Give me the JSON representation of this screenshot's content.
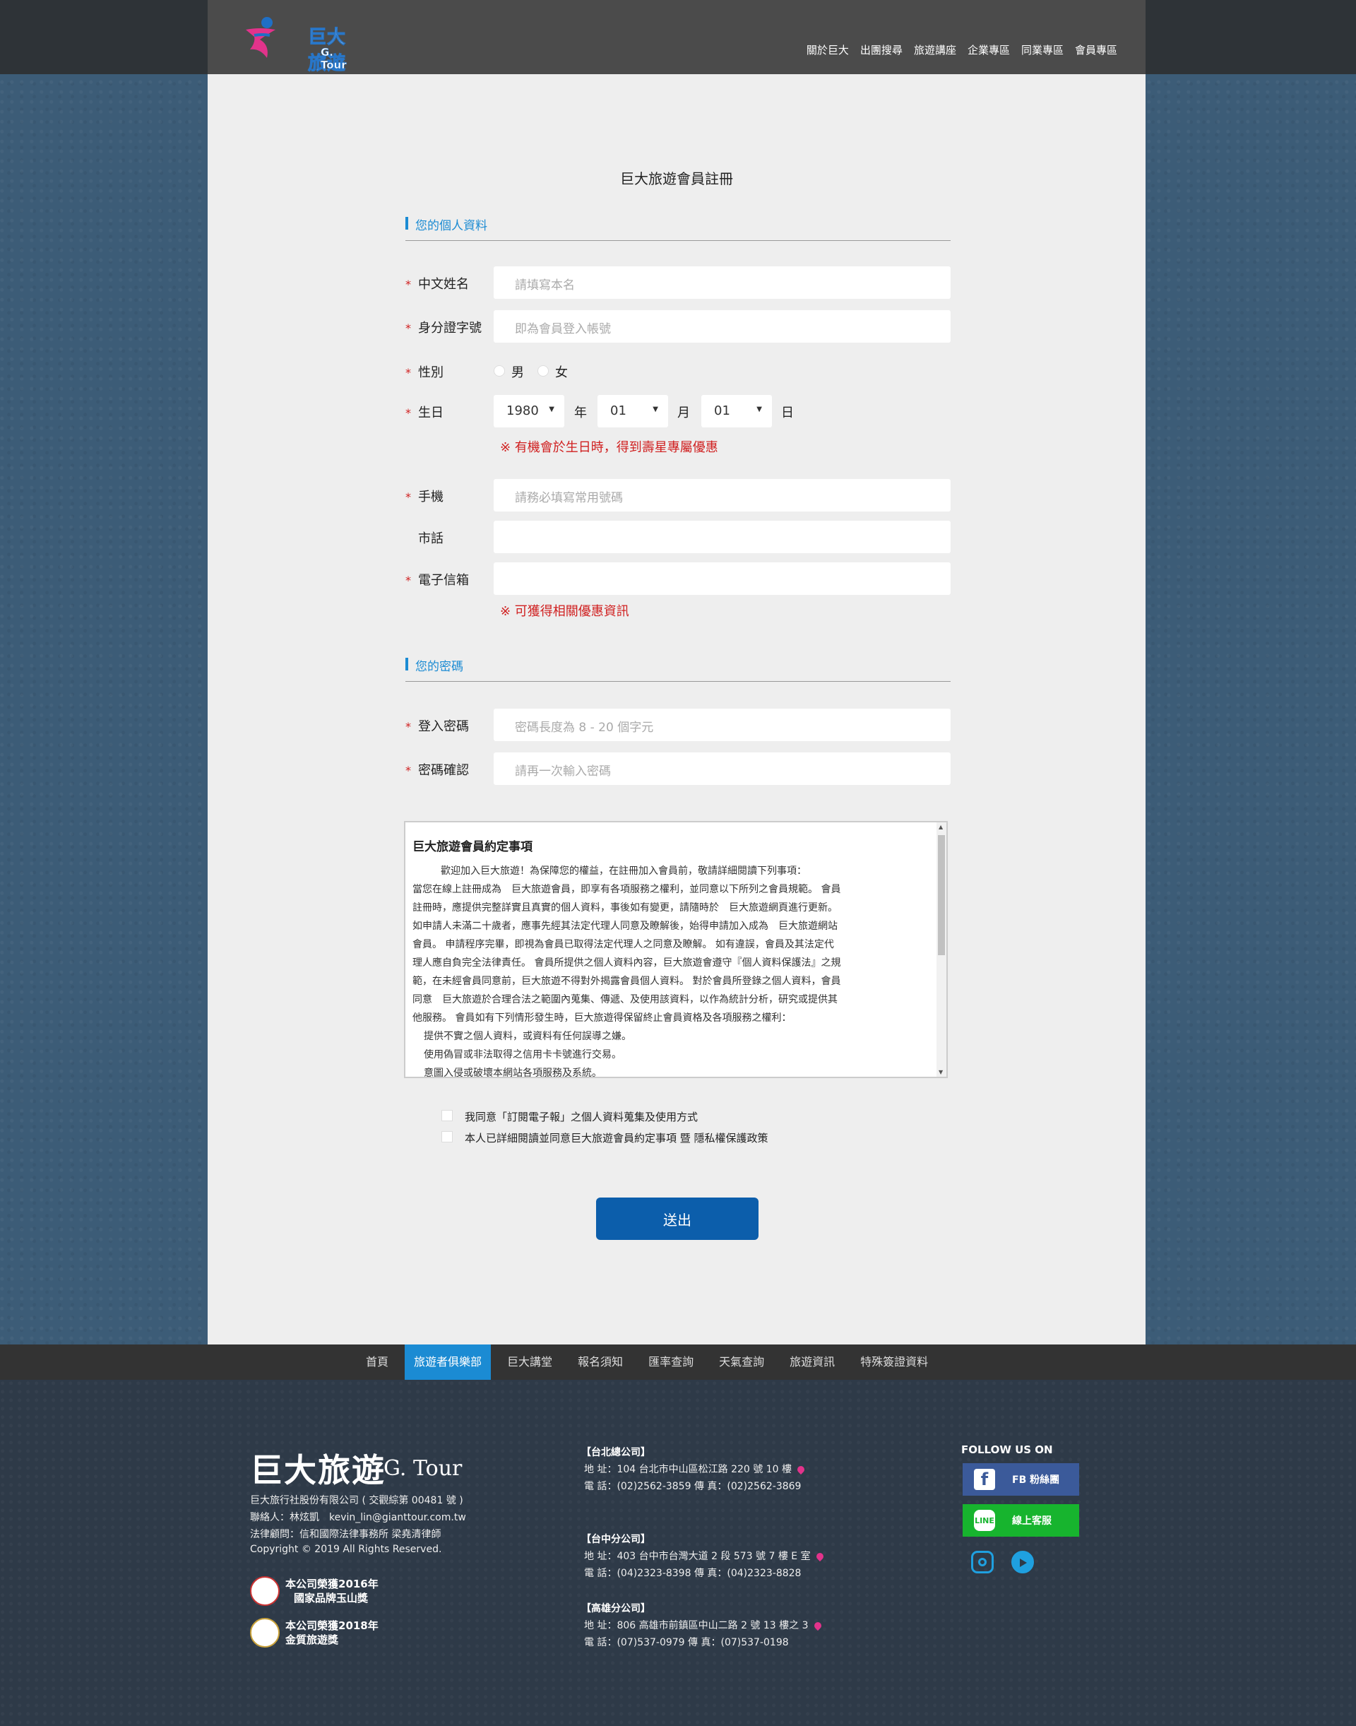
{
  "header": {
    "logo_main": "巨大旅遊",
    "logo_sub": "G. Tour",
    "nav": [
      "關於巨大",
      "出團搜尋",
      "旅遊講座",
      "企業專區",
      "同業專區",
      "會員專區"
    ]
  },
  "form": {
    "title": "巨大旅遊會員註冊",
    "section_personal": "您的個人資料",
    "section_password": "您的密碼",
    "required_mark": "*",
    "fields": {
      "name": {
        "label": "中文姓名",
        "placeholder": "請填寫本名"
      },
      "id_number": {
        "label": "身分證字號",
        "placeholder": "即為會員登入帳號"
      },
      "gender": {
        "label": "性別",
        "male": "男",
        "female": "女"
      },
      "birthday": {
        "label": "生日",
        "year": "1980",
        "month": "01",
        "day": "01",
        "year_unit": "年",
        "month_unit": "月",
        "day_unit": "日",
        "note": "※ 有機會於生日時，得到壽星專屬優惠"
      },
      "mobile": {
        "label": "手機",
        "placeholder": "請務必填寫常用號碼"
      },
      "phone": {
        "label": "市話",
        "placeholder": ""
      },
      "email": {
        "label": "電子信箱",
        "placeholder": "",
        "note": "※ 可獲得相關優惠資訊"
      },
      "password": {
        "label": "登入密碼",
        "placeholder": "密碼長度為 8 - 20 個字元"
      },
      "password_confirm": {
        "label": "密碼確認",
        "placeholder": "請再一次輸入密碼"
      }
    },
    "terms": {
      "title": "巨大旅遊會員約定事項",
      "lines": [
        "歡迎加入巨大旅遊！為保障您的權益，在註冊加入會員前，敬請詳細閱讀下列事項：",
        "當您在線上註冊成為　巨大旅遊會員，即享有各項服務之權利，並同意以下所列之會員規範。 會員",
        "註冊時，應提供完整詳實且真實的個人資料，事後如有變更，請隨時於　巨大旅遊網頁進行更新。",
        "如申請人未滿二十歲者，應事先經其法定代理人同意及瞭解後，始得申請加入成為　巨大旅遊網站",
        "會員。 申請程序完畢，即視為會員已取得法定代理人之同意及瞭解。 如有違誤，會員及其法定代",
        "理人應自負完全法律責任。 會員所提供之個人資料內容，巨大旅遊會遵守『個人資料保護法』之規",
        "範，在未經會員同意前，巨大旅遊不得對外揭露會員個人資料。 對於會員所登錄之個人資料，會員",
        "同意　巨大旅遊於合理合法之範圍內蒐集、傳遞、及使用該資料，以作為統計分析，研究或提供其",
        "他服務。 會員如有下列情形發生時，巨大旅遊得保留終止會員資格及各項服務之權利：",
        "提供不實之個人資料，或資料有任何誤導之嫌。",
        "使用偽冒或非法取得之信用卡卡號進行交易。",
        "意圖入侵或破壞本網站各項服務及系統。"
      ]
    },
    "agree_newsletter": "我同意「訂閱電子報」之個人資料蒐集及使用方式",
    "agree_terms": "本人已詳細閱讀並同意巨大旅遊會員約定事項 暨 隱私權保護政策",
    "submit": "送出"
  },
  "bottom_nav": [
    "首頁",
    "旅遊者俱樂部",
    "巨大講堂",
    "報名須知",
    "匯率查詢",
    "天氣查詢",
    "旅遊資訊",
    "特殊簽證資料"
  ],
  "bottom_nav_active": 1,
  "footer": {
    "logo_main": "巨大旅遊",
    "logo_sub": "G. Tour",
    "company": "巨大旅行社股份有限公司 ( 交觀綜第 00481 號 )",
    "contact": "聯絡人：林炫凱　kevin_lin@gianttour.com.tw",
    "legal": "法律顧問：信和國際法律事務所 梁堯清律師",
    "copyright": "Copyright © 2019 All Rights Reserved.",
    "award1_line1": "本公司榮獲2016年",
    "award1_line2": "國家品牌玉山獎",
    "award2_line1": "本公司榮獲2018年",
    "award2_line2": "金質旅遊獎",
    "offices": [
      {
        "name": "【台北總公司】",
        "address": "地 址：104 台北市中山區松江路 220 號 10 樓",
        "phone": "電 話：(02)2562-3859 傳 真：(02)2562-3869"
      },
      {
        "name": "【台中分公司】",
        "address": "地 址：403 台中市台灣大道 2 段 573 號 7 樓 E 室",
        "phone": "電 話：(04)2323-8398 傳 真：(04)2323-8828"
      },
      {
        "name": "【高雄分公司】",
        "address": "地 址：806 高雄市前鎮區中山二路 2 號 13 樓之 3",
        "phone": "電 話：(07)537-0979 傳 真：(07)537-0198"
      }
    ],
    "follow": "FOLLOW US ON",
    "fb_label": "FB 粉絲團",
    "line_label": "線上客服",
    "line_icon_text": "LINE",
    "fb_icon_text": "f"
  },
  "colors": {
    "accent": "#1b8bd3",
    "submit": "#0c5eab",
    "required": "#d02020",
    "line_green": "#17b42e",
    "fb_blue": "#3b5a9a"
  }
}
